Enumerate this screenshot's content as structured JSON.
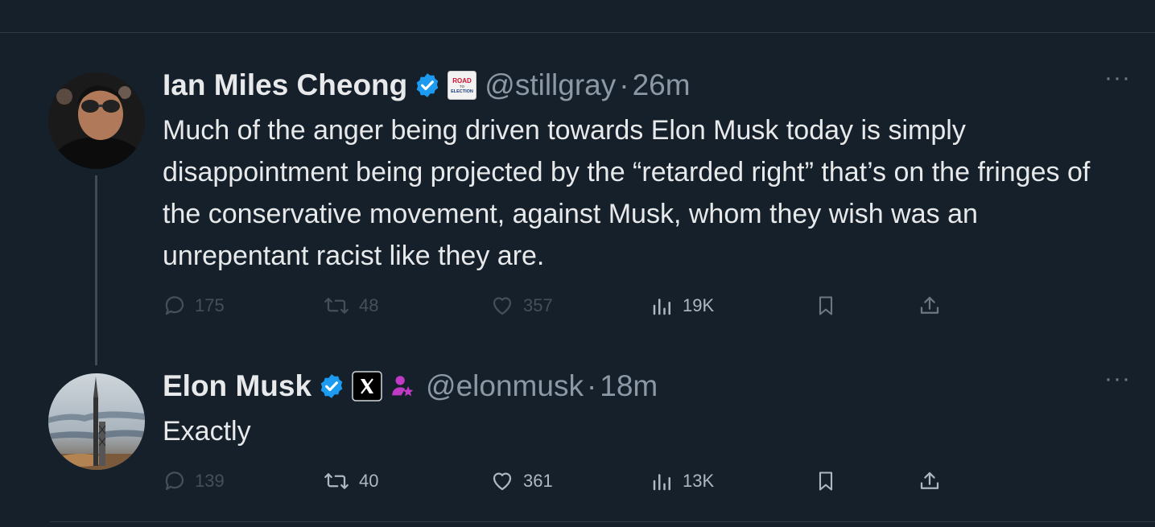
{
  "tweets": [
    {
      "display_name": "Ian Miles Cheong",
      "handle": "@stillgray",
      "separator": "·",
      "time": "26m",
      "affiliate_badge_text": "ROAD TO ELECTION",
      "text": "Much of the anger being driven towards Elon Musk today is simply disappointment being projected by the “retarded right” that’s on the fringes of the conservative movement, against Musk, whom they wish was an unrepentant racist like they are.",
      "stats": {
        "replies": "175",
        "reposts": "48",
        "likes": "357",
        "views": "19K"
      }
    },
    {
      "display_name": "Elon Musk",
      "handle": "@elonmusk",
      "separator": "·",
      "time": "18m",
      "text": "Exactly",
      "stats": {
        "replies": "139",
        "reposts": "40",
        "likes": "361",
        "views": "13K"
      }
    }
  ],
  "more_label": "···",
  "icons": {
    "verified": "verified-badge-icon",
    "reply": "reply-icon",
    "repost": "repost-icon",
    "like": "heart-icon",
    "views": "views-chart-icon",
    "bookmark": "bookmark-icon",
    "share": "share-icon"
  },
  "colors": {
    "background": "#16202b",
    "text": "#e7e9ea",
    "muted": "#8b98a5",
    "verified": "#1d9bf0",
    "person_badge": "#c03ac6"
  }
}
